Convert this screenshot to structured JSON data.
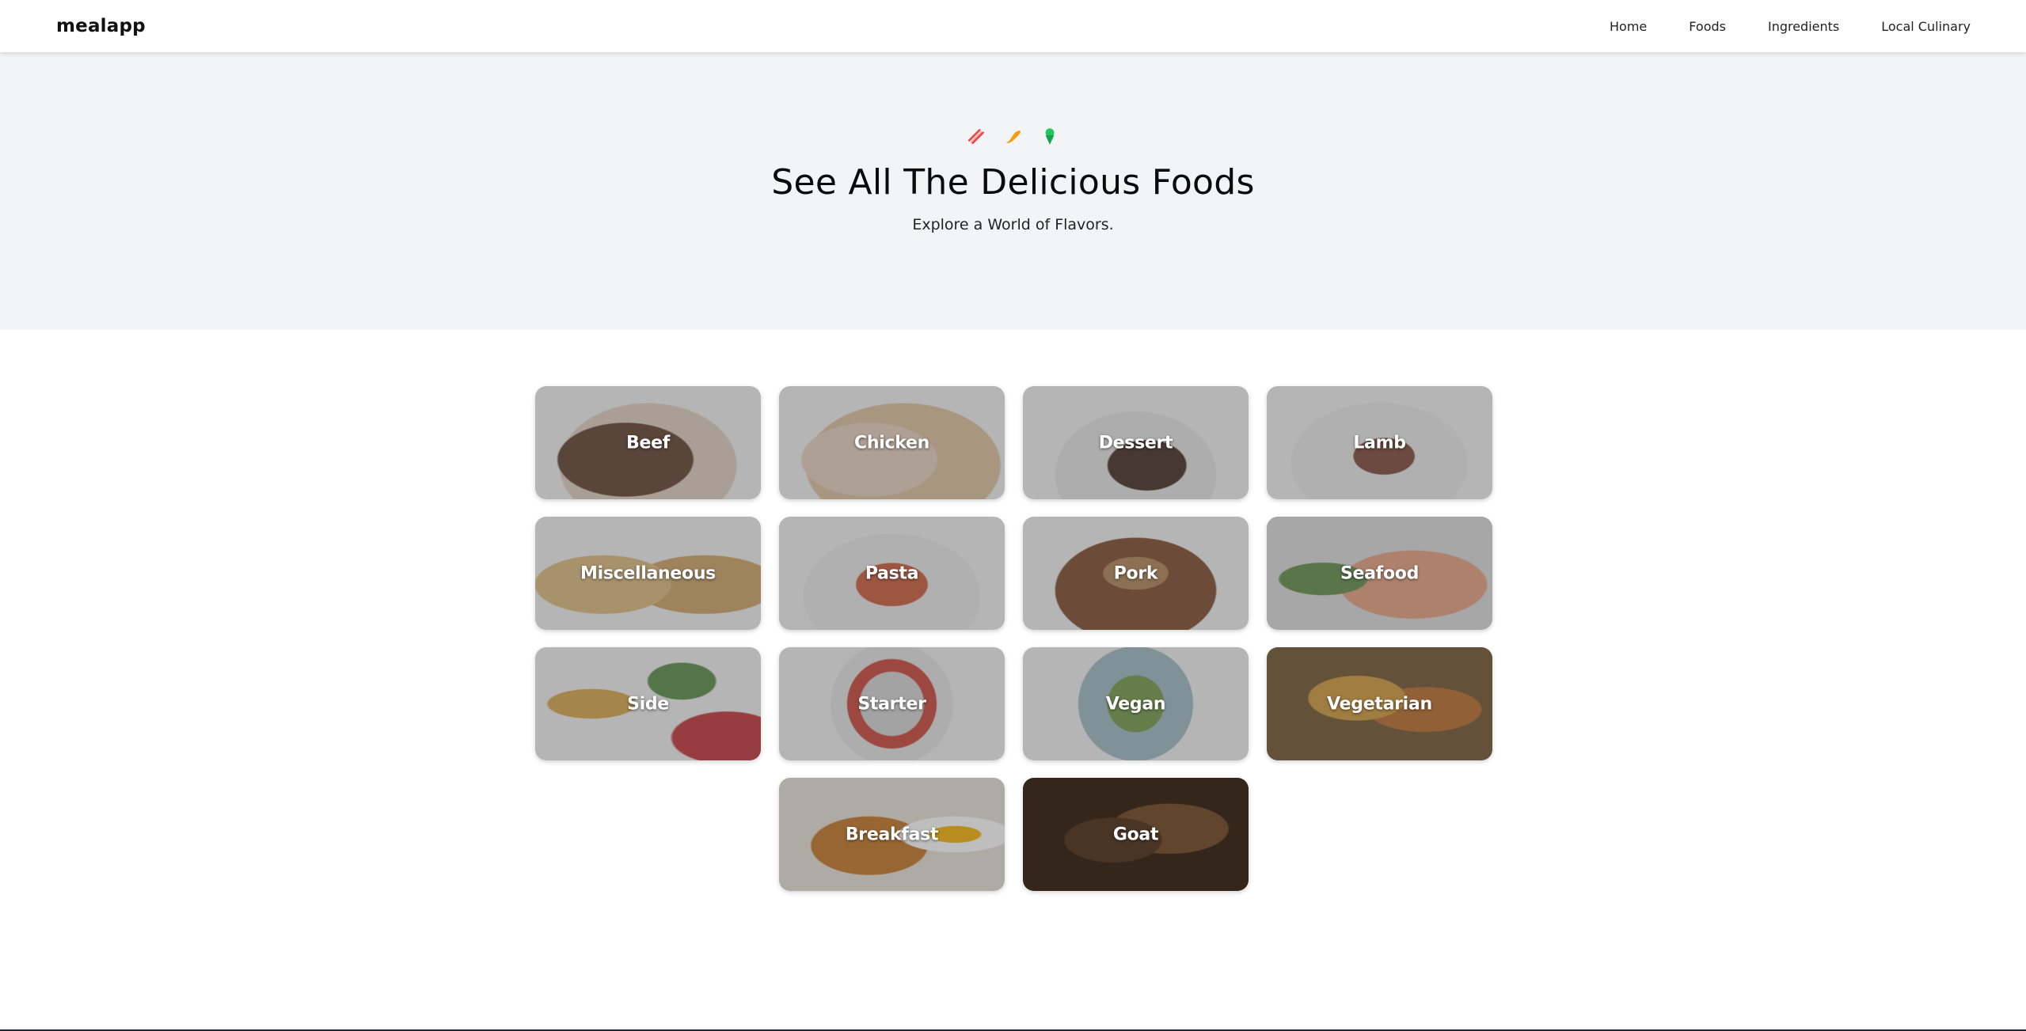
{
  "header": {
    "brand": "mealapp",
    "nav": [
      "Home",
      "Foods",
      "Ingredients",
      "Local Culinary"
    ]
  },
  "hero": {
    "icons": [
      "bacon-icon",
      "sausage-icon",
      "ice-cream-icon"
    ],
    "title": "See All The Delicious Foods",
    "subtitle": "Explore a World of Flavors."
  },
  "categories": [
    {
      "label": "Beef"
    },
    {
      "label": "Chicken"
    },
    {
      "label": "Dessert"
    },
    {
      "label": "Lamb"
    },
    {
      "label": "Miscellaneous"
    },
    {
      "label": "Pasta"
    },
    {
      "label": "Pork"
    },
    {
      "label": "Seafood"
    },
    {
      "label": "Side"
    },
    {
      "label": "Starter"
    },
    {
      "label": "Vegan"
    },
    {
      "label": "Vegetarian"
    },
    {
      "label": "Breakfast"
    },
    {
      "label": "Goat"
    }
  ],
  "colors": {
    "hero_bg": "#f3f4f6",
    "icon_red": "#ef4444",
    "icon_orange": "#f59e0b",
    "icon_green": "#22c55e"
  }
}
